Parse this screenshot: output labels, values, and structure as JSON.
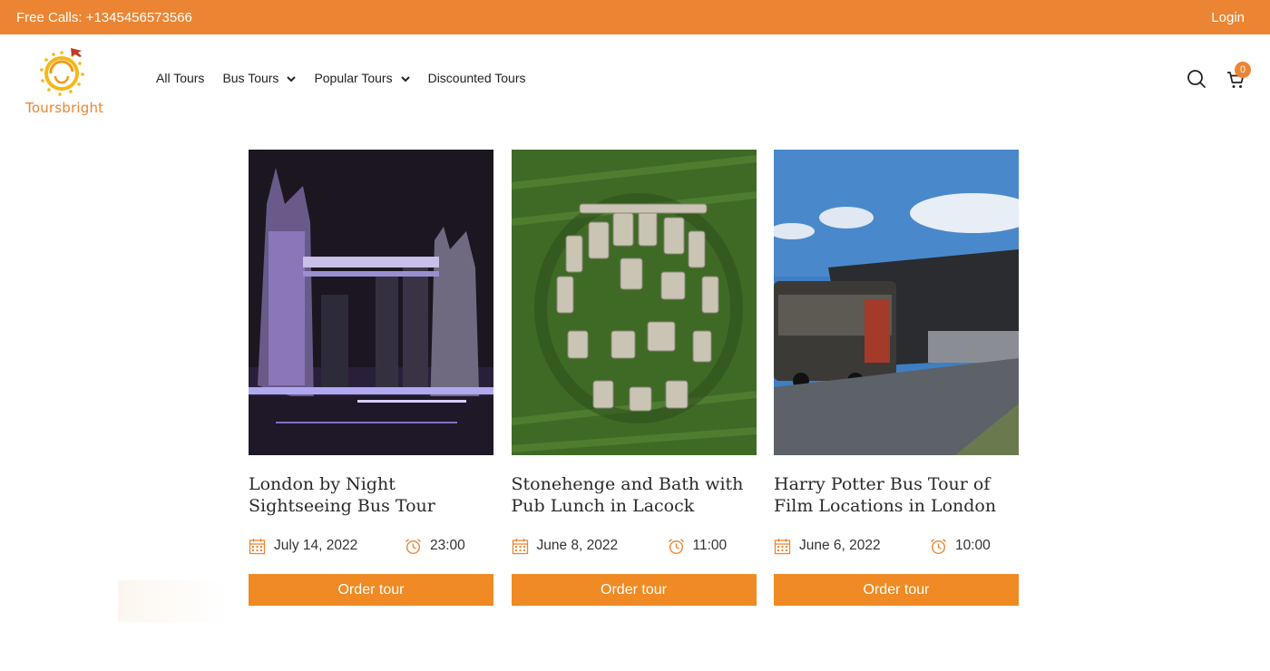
{
  "topbar": {
    "phone": "Free Calls: +1345456573566",
    "login": "Login"
  },
  "logo": {
    "text": "Toursbright"
  },
  "nav": [
    {
      "label": "All Tours",
      "dropdown": false
    },
    {
      "label": "Bus Tours",
      "dropdown": true
    },
    {
      "label": "Popular Tours",
      "dropdown": true
    },
    {
      "label": "Discounted Tours",
      "dropdown": false
    }
  ],
  "cart": {
    "count": "0"
  },
  "colors": {
    "accent": "#ec8533",
    "button": "#f08a24"
  },
  "tours": [
    {
      "title": "London by Night Sightseeing Bus Tour",
      "date": "July 14, 2022",
      "time": "23:00",
      "button": "Order tour"
    },
    {
      "title": "Stonehenge and Bath with Pub Lunch in Lacock",
      "date": "June 8, 2022",
      "time": "11:00",
      "button": "Order tour"
    },
    {
      "title": "Harry Potter Bus Tour of Film Locations in London",
      "date": "June 6, 2022",
      "time": "10:00",
      "button": "Order tour"
    }
  ]
}
